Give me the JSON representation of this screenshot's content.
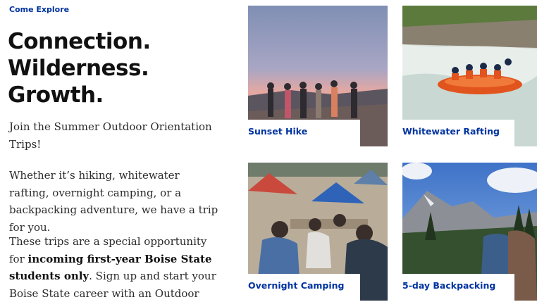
{
  "eyebrow": "Come Explore",
  "headline": {
    "line1": "Connection.",
    "line2": "Wilderness.",
    "line3": "Growth."
  },
  "intro": "Join the Summer Outdoor Orientation Trips!",
  "description": "Whether it’s hiking, whitewater rafting, overnight camping, or a backpacking adventure, we have a trip for you.",
  "special": {
    "before": "These trips are a special opportunity for ",
    "bold": "incoming first-year Boise State students only",
    "after": ". Sign up and start your Boise State career with an Outdoor"
  },
  "trips": [
    {
      "caption": "Sunset Hike",
      "icon": "sunset-hike-photo"
    },
    {
      "caption": "Whitewater Rafting",
      "icon": "rafting-photo"
    },
    {
      "caption": "Overnight Camping",
      "icon": "camping-photo"
    },
    {
      "caption": "5-day Backpacking",
      "icon": "backpacking-photo"
    }
  ],
  "colors": {
    "brand_blue": "#0033a0",
    "headline": "#111111"
  }
}
